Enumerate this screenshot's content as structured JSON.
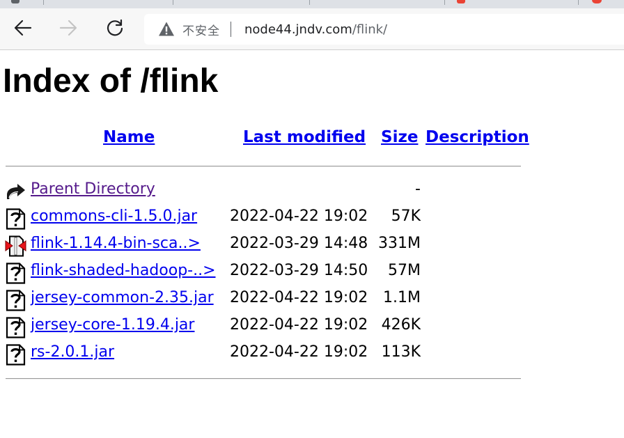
{
  "browser": {
    "security_label": "不安全",
    "url_host": "node44.jndv.com",
    "url_path": "/flink/"
  },
  "page": {
    "title": "Index of /flink",
    "columns": {
      "name": "Name",
      "last_modified": "Last modified",
      "size": "Size",
      "description": "Description"
    },
    "parent": {
      "name": "Parent Directory",
      "size": "-",
      "icon": "back-icon"
    },
    "files": [
      {
        "name": "commons-cli-1.5.0.jar",
        "modified": "2022-04-22 19:02",
        "size": "57K",
        "icon": "unknown-file-icon"
      },
      {
        "name": "flink-1.14.4-bin-sca..>",
        "modified": "2022-03-29 14:48",
        "size": "331M",
        "icon": "compressed-file-icon"
      },
      {
        "name": "flink-shaded-hadoop-..>",
        "modified": "2022-03-29 14:50",
        "size": "57M",
        "icon": "unknown-file-icon"
      },
      {
        "name": "jersey-common-2.35.jar",
        "modified": "2022-04-22 19:02",
        "size": "1.1M",
        "icon": "unknown-file-icon"
      },
      {
        "name": "jersey-core-1.19.4.jar",
        "modified": "2022-04-22 19:02",
        "size": "426K",
        "icon": "unknown-file-icon"
      },
      {
        "name": "rs-2.0.1.jar",
        "modified": "2022-04-22 19:02",
        "size": "113K",
        "icon": "unknown-file-icon"
      }
    ]
  }
}
